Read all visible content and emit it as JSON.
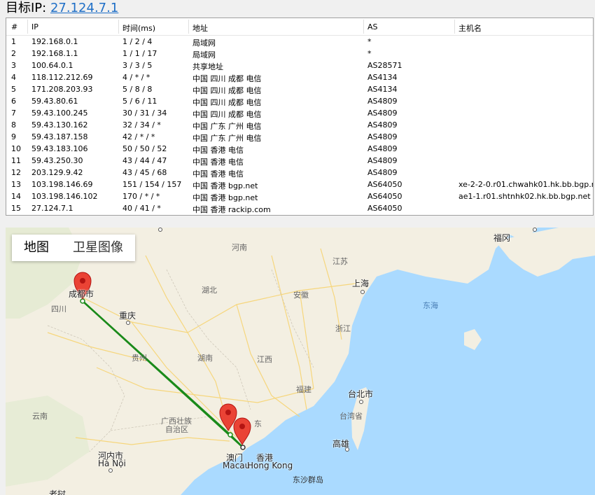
{
  "header": {
    "label": "目标IP:",
    "ip": "27.124.7.1"
  },
  "table": {
    "columns": [
      "#",
      "IP",
      "时间(ms)",
      "地址",
      "AS",
      "主机名"
    ],
    "rows": [
      {
        "n": "1",
        "ip": "192.168.0.1",
        "time": "1 / 2 / 4",
        "addr": "局域网",
        "as": "*",
        "host": ""
      },
      {
        "n": "2",
        "ip": "192.168.1.1",
        "time": "1 / 1 / 17",
        "addr": "局域网",
        "as": "*",
        "host": ""
      },
      {
        "n": "3",
        "ip": "100.64.0.1",
        "time": "3 / 3 / 5",
        "addr": "共享地址",
        "as": "AS28571",
        "host": ""
      },
      {
        "n": "4",
        "ip": "118.112.212.69",
        "time": "4 / * / *",
        "addr": "中国 四川 成都 电信",
        "as": "AS4134",
        "host": ""
      },
      {
        "n": "5",
        "ip": "171.208.203.93",
        "time": "5 / 8 / 8",
        "addr": "中国 四川 成都 电信",
        "as": "AS4134",
        "host": ""
      },
      {
        "n": "6",
        "ip": "59.43.80.61",
        "time": "5 / 6 / 11",
        "addr": "中国 四川 成都 电信",
        "as": "AS4809",
        "host": ""
      },
      {
        "n": "7",
        "ip": "59.43.100.245",
        "time": "30 / 31 / 34",
        "addr": "中国 四川 成都 电信",
        "as": "AS4809",
        "host": ""
      },
      {
        "n": "8",
        "ip": "59.43.130.162",
        "time": "32 / 34 / *",
        "addr": "中国 广东 广州 电信",
        "as": "AS4809",
        "host": ""
      },
      {
        "n": "9",
        "ip": "59.43.187.158",
        "time": "42 / * / *",
        "addr": "中国 广东 广州 电信",
        "as": "AS4809",
        "host": ""
      },
      {
        "n": "10",
        "ip": "59.43.183.106",
        "time": "50 / 50 / 52",
        "addr": "中国 香港 电信",
        "as": "AS4809",
        "host": ""
      },
      {
        "n": "11",
        "ip": "59.43.250.30",
        "time": "43 / 44 / 47",
        "addr": "中国 香港 电信",
        "as": "AS4809",
        "host": ""
      },
      {
        "n": "12",
        "ip": "203.129.9.42",
        "time": "43 / 45 / 68",
        "addr": "中国 香港 电信",
        "as": "AS4809",
        "host": ""
      },
      {
        "n": "13",
        "ip": "103.198.146.69",
        "time": "151 / 154 / 157",
        "addr": "中国 香港 bgp.net",
        "as": "AS64050",
        "host": "xe-2-2-0.r01.chwahk01.hk.bb.bgp.net"
      },
      {
        "n": "14",
        "ip": "103.198.146.102",
        "time": "170 / * / *",
        "addr": "中国 香港 bgp.net",
        "as": "AS64050",
        "host": "ae1-1.r01.shtnhk02.hk.bb.bgp.net"
      },
      {
        "n": "15",
        "ip": "27.124.7.1",
        "time": "40 / 41 / *",
        "addr": "中国 香港 rackip.com",
        "as": "AS64050",
        "host": ""
      }
    ]
  },
  "map": {
    "tabs": {
      "map": "地图",
      "satellite": "卫星图像"
    },
    "route_color": "#1a8a1a",
    "marker_color": "#ea4335",
    "land_color": "#f3efe2",
    "water_color": "#aadaff",
    "labels": {
      "chengdu": "成都市",
      "chongqing": "重庆",
      "shanghai": "上海",
      "fukuoka": "福冈",
      "taipei": "台北市",
      "gaoxiong": "高雄",
      "macau_cn": "澳门",
      "macau_en": "Macau",
      "hk_cn": "香港",
      "hk_en": "Hong Kong",
      "hanoi_cn": "河内市",
      "hanoi_en": "Hà Nội",
      "sichuan": "四川",
      "henan": "河南",
      "hubei": "湖北",
      "anhui": "安徽",
      "jiangsu": "江苏",
      "zhejiang": "浙江",
      "hunan": "湖南",
      "jiangxi": "江西",
      "fujian": "福建",
      "guizhou": "贵州",
      "guangxi1": "广西壮族",
      "guangxi2": "自治区",
      "guangdong": "东",
      "yunnan": "云南",
      "taiwan": "台湾省",
      "donghai": "东海",
      "dongsha": "东沙群岛",
      "laos": "老挝"
    }
  }
}
